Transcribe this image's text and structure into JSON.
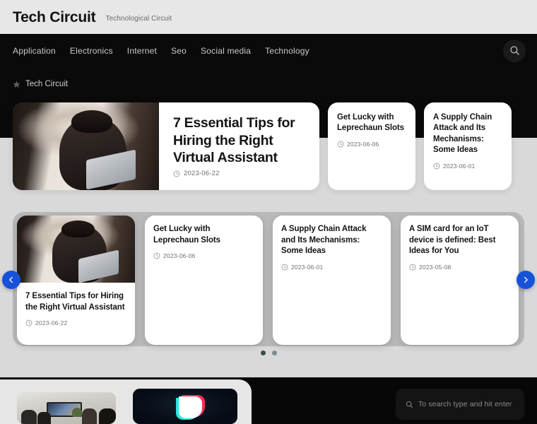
{
  "site": {
    "title": "Tech Circuit",
    "tagline": "Technological Circuit"
  },
  "nav": {
    "items": [
      {
        "label": "Application"
      },
      {
        "label": "Electronics"
      },
      {
        "label": "Internet"
      },
      {
        "label": "Seo"
      },
      {
        "label": "Social media"
      },
      {
        "label": "Technology"
      }
    ],
    "search_icon": "search-icon"
  },
  "breadcrumb": {
    "icon": "star-icon",
    "label": "Tech Circuit"
  },
  "hero": {
    "featured": {
      "title": "7 Essential Tips for Hiring the Right Virtual Assistant",
      "date": "2023-06-22",
      "date_icon": "clock-icon"
    },
    "side_cards": [
      {
        "title": "Get Lucky with Leprechaun Slots",
        "date": "2023-06-06",
        "date_icon": "clock-icon"
      },
      {
        "title": "A Supply Chain Attack and Its Mechanisms: Some Ideas",
        "date": "2023-06-01",
        "date_icon": "clock-icon"
      }
    ]
  },
  "slider": {
    "prev_icon": "chevron-left-icon",
    "next_icon": "chevron-right-icon",
    "slides": [
      {
        "title": "7 Essential Tips for Hiring the Right Virtual Assistant",
        "date": "2023-06-22",
        "date_icon": "clock-icon",
        "has_image": true
      },
      {
        "title": "Get Lucky with Leprechaun Slots",
        "date": "2023-06-06",
        "date_icon": "clock-icon",
        "has_image": false
      },
      {
        "title": "A Supply Chain Attack and Its Mechanisms: Some Ideas",
        "date": "2023-06-01",
        "date_icon": "clock-icon",
        "has_image": false
      },
      {
        "title": "A SIM card for an IoT device is defined: Best Ideas for You",
        "date": "2023-05-08",
        "date_icon": "clock-icon",
        "has_image": false
      }
    ],
    "pagination": [
      {
        "active": true
      },
      {
        "active": false
      }
    ]
  },
  "bottom": {
    "thumbnails": [
      {
        "name": "meeting-room-photo"
      },
      {
        "name": "tiktok-logo-photo"
      }
    ]
  },
  "search": {
    "placeholder": "To search type and hit enter",
    "icon": "search-icon"
  },
  "colors": {
    "accent_blue": "#1552d8",
    "dark": "#0a0a0a",
    "brandbar": "#e7e7e7",
    "page_gray": "#d9d9d9",
    "slider_gray": "#b9b9b9"
  }
}
